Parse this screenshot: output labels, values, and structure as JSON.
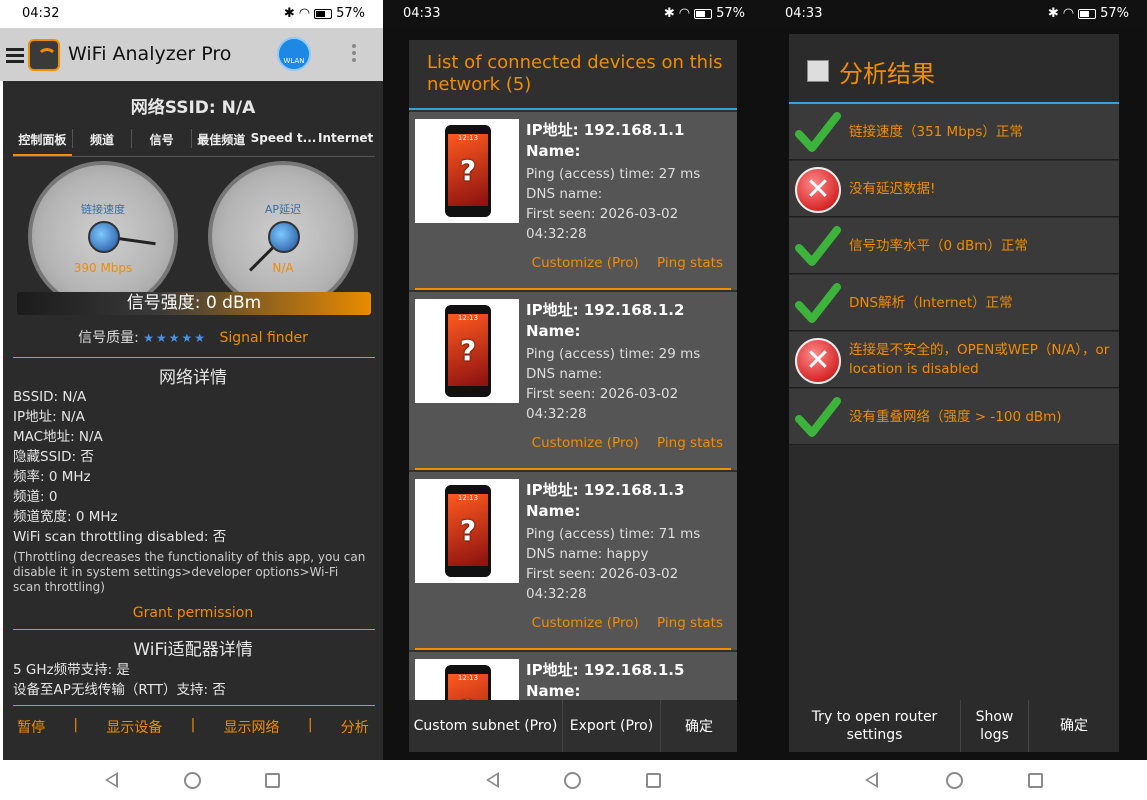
{
  "panel1": {
    "status": {
      "time": "04:32",
      "battery": "57%"
    },
    "app_title": "WiFi Analyzer Pro",
    "wlan_label": "WLAN",
    "ssid": "网络SSID:  N/A",
    "tabs": [
      "控制面板",
      "频道",
      "信号",
      "最佳频道",
      "Speed t...",
      "Internet"
    ],
    "gauge_speed": {
      "label": "链接速度",
      "value": "390 Mbps"
    },
    "gauge_ap": {
      "label": "AP延迟",
      "value": "N/A"
    },
    "signal_strength": "信号强度:  0 dBm",
    "signal_quality_label": "信号质量:",
    "stars": "★★★★★",
    "signal_finder": "Signal finder",
    "network_details_title": "网络详情",
    "details": [
      "BSSID:  N/A",
      "IP地址:  N/A",
      "MAC地址:  N/A",
      "隐藏SSID:  否",
      "频率:  0 MHz",
      "频道:  0",
      "频道宽度:  0 MHz",
      "WiFi scan throttling disabled: 否"
    ],
    "throttle_note": "(Throttling decreases the functionality of this app, you can disable it in system settings>developer options>Wi-Fi scan throttling)",
    "grant_permission": "Grant permission",
    "adapter_title": "WiFi适配器详情",
    "adapter": [
      "5 GHz频带支持: 是",
      "设备至AP无线传输（RTT）支持: 否"
    ],
    "bottom_actions": [
      "暂停",
      "显示设备",
      "显示网络",
      "分析"
    ]
  },
  "panel2": {
    "status": {
      "time": "04:33",
      "battery": "57%"
    },
    "title": "List of connected devices on this network (5)",
    "devices": [
      {
        "ip": "IP地址:    192.168.1.1",
        "name": "Name:",
        "ping": "Ping (access) time: 27 ms",
        "dns": "DNS name:",
        "first_seen": "First seen: 2026-03-02",
        "first_seen_time": "04:32:28"
      },
      {
        "ip": "IP地址:    192.168.1.2",
        "name": "Name:",
        "ping": "Ping (access) time: 29 ms",
        "dns": "DNS name:",
        "first_seen": "First seen: 2026-03-02",
        "first_seen_time": "04:32:28"
      },
      {
        "ip": "IP地址:    192.168.1.3",
        "name": "Name:",
        "ping": "Ping (access) time: 71 ms",
        "dns": "DNS name: happy",
        "first_seen": "First seen: 2026-03-02",
        "first_seen_time": "04:32:28"
      },
      {
        "ip": "IP地址:    192.168.1.5",
        "name": "Name:",
        "ping": "",
        "dns": "",
        "first_seen": "",
        "first_seen_time": ""
      }
    ],
    "customize": "Customize (Pro)",
    "ping_stats": "Ping stats",
    "phone_clock": "12:13",
    "buttons": [
      "Custom subnet (Pro)",
      "Export (Pro)",
      "确定"
    ]
  },
  "panel3": {
    "status": {
      "time": "04:33",
      "battery": "57%"
    },
    "title": "分析结果",
    "results": [
      {
        "status": "ok",
        "text": "链接速度（351 Mbps）正常"
      },
      {
        "status": "error",
        "text": "没有延迟数据!"
      },
      {
        "status": "ok",
        "text": "信号功率水平（0 dBm）正常"
      },
      {
        "status": "ok",
        "text": "DNS解析（Internet）正常"
      },
      {
        "status": "error",
        "text": "连接是不安全的，OPEN或WEP（N/A），or location is disabled"
      },
      {
        "status": "ok",
        "text": "没有重叠网络（强度 > -100 dBm)"
      }
    ],
    "buttons": [
      "Try to open router settings",
      "Show logs",
      "确定"
    ]
  },
  "colors": {
    "accent": "#f28c00",
    "divider": "#33a3e0",
    "ok": "#3cb43c",
    "error": "#c40000"
  }
}
